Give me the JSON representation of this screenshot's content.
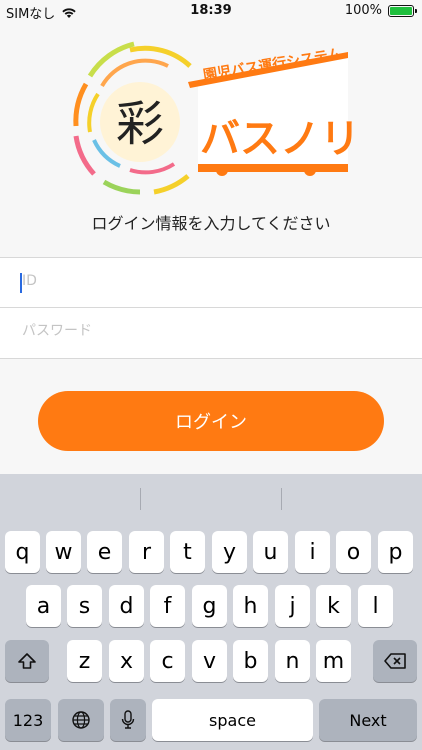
{
  "status": {
    "carrier": "SIMなし",
    "time": "18:39",
    "battery": "100%"
  },
  "logo": {
    "kanji": "彩",
    "tagline": "園児バス運行システム",
    "title": "バスノリ"
  },
  "subtitle": "ログイン情報を入力してください",
  "form": {
    "id_placeholder": "ID",
    "password_placeholder": "パスワード",
    "login_label": "ログイン"
  },
  "keyboard": {
    "row1": [
      "q",
      "w",
      "e",
      "r",
      "t",
      "y",
      "u",
      "i",
      "o",
      "p"
    ],
    "row2": [
      "a",
      "s",
      "d",
      "f",
      "g",
      "h",
      "j",
      "k",
      "l"
    ],
    "row3": [
      "z",
      "x",
      "c",
      "v",
      "b",
      "n",
      "m"
    ],
    "numbers_label": "123",
    "space_label": "space",
    "next_label": "Next"
  },
  "colors": {
    "accent": "#ff7a12",
    "caret": "#2a6ae0"
  }
}
